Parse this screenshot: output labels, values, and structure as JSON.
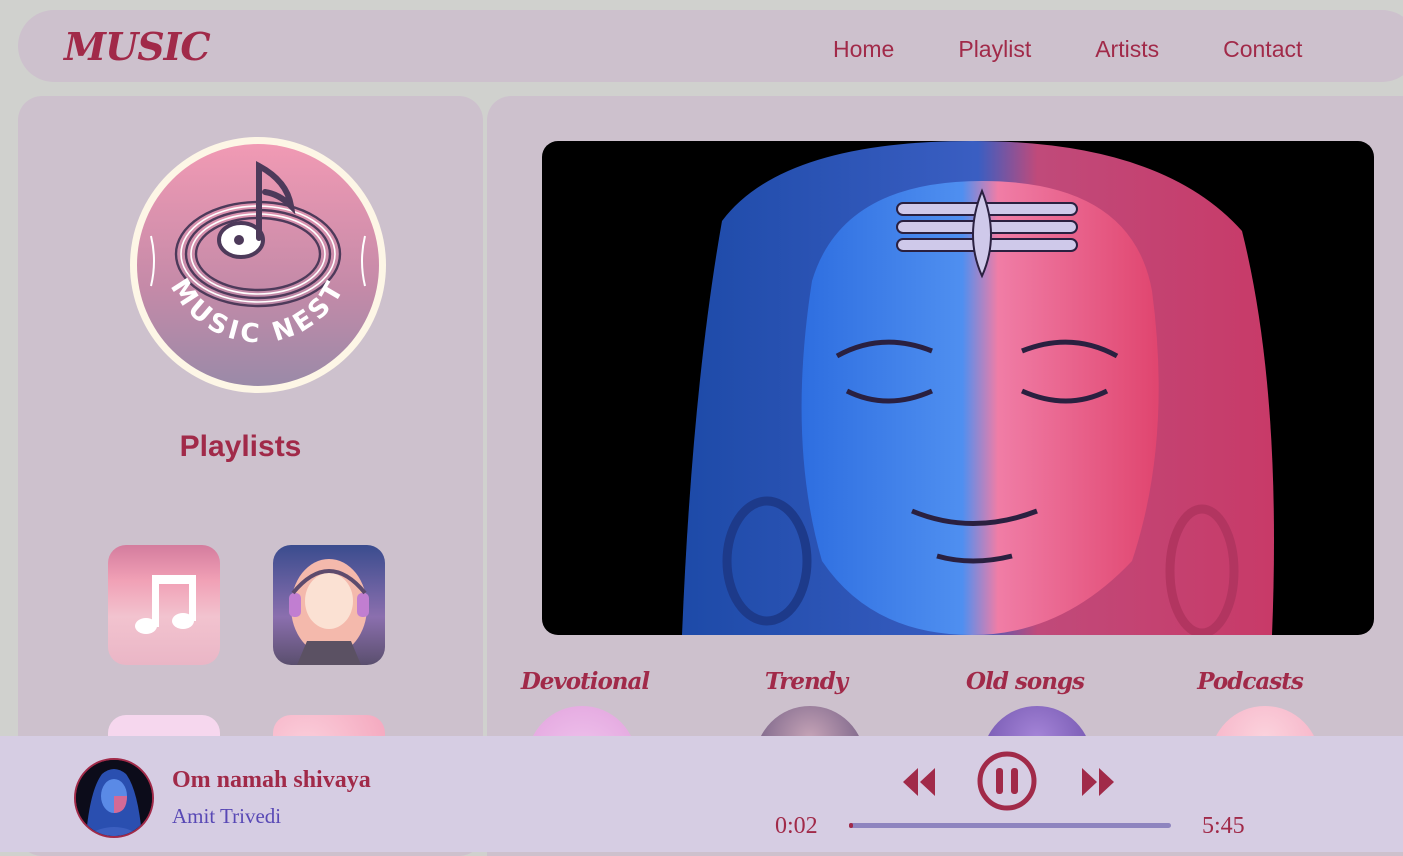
{
  "nav": {
    "brand": "MUSIC",
    "links": [
      "Home",
      "Playlist",
      "Artists",
      "Contact"
    ]
  },
  "sidebar": {
    "logo_text": "MUSIC NEST",
    "title": "Playlists"
  },
  "categories": [
    "Devotional",
    "Trendy",
    "Old songs",
    "Podcasts"
  ],
  "player": {
    "song_title": "Om namah shivaya",
    "artist": "Amit Trivedi",
    "current_time": "0:02",
    "duration": "5:45",
    "progress": 0.006
  },
  "colors": {
    "accent": "#a12a49",
    "panel": "#cdc1cd",
    "player_bg": "#d6cde3",
    "artist_text": "#5848b5"
  },
  "icons": {
    "prev": "rewind-icon",
    "pause": "pause-icon",
    "next": "fast-forward-icon"
  }
}
